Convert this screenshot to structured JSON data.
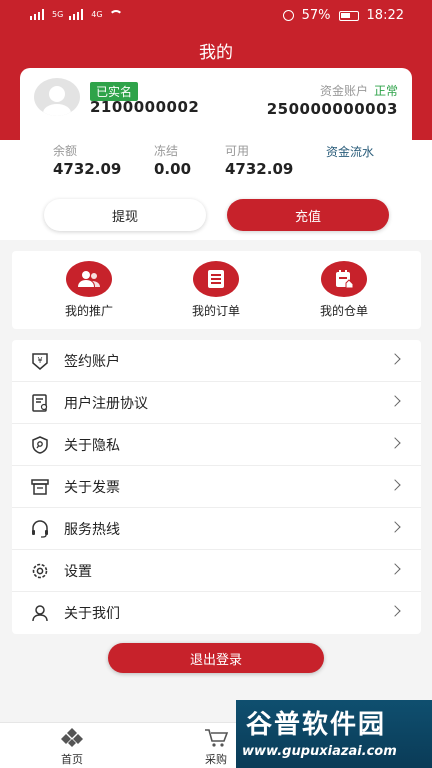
{
  "status_bar": {
    "left_indicators": [
      "5G",
      "4G"
    ],
    "battery": "57%",
    "time": "18:22"
  },
  "header": {
    "title": "我的"
  },
  "account": {
    "verified_badge": "已实名",
    "user_id": "2100000002",
    "fund_account_label": "资金账户",
    "fund_status": "正常",
    "fund_account_number": "250000000003",
    "stats": [
      {
        "label": "余额",
        "value": "4732.09"
      },
      {
        "label": "冻结",
        "value": "0.00"
      },
      {
        "label": "可用",
        "value": "4732.09"
      }
    ],
    "fund_flow_link": "资金流水",
    "withdraw_label": "提现",
    "recharge_label": "充值"
  },
  "shortcuts": [
    {
      "label": "我的推广",
      "icon": "users-icon"
    },
    {
      "label": "我的订单",
      "icon": "list-icon"
    },
    {
      "label": "我的仓单",
      "icon": "warehouse-receipt-icon"
    }
  ],
  "menu": [
    {
      "label": "签约账户",
      "icon": "yuan-shield-icon"
    },
    {
      "label": "用户注册协议",
      "icon": "document-user-icon"
    },
    {
      "label": "关于隐私",
      "icon": "privacy-shield-icon"
    },
    {
      "label": "关于发票",
      "icon": "invoice-icon"
    },
    {
      "label": "服务热线",
      "icon": "headset-icon"
    },
    {
      "label": "设置",
      "icon": "gear-icon"
    },
    {
      "label": "关于我们",
      "icon": "person-icon"
    }
  ],
  "logout_label": "退出登录",
  "bottom_nav": [
    {
      "label": "首页",
      "icon": "home-icon"
    },
    {
      "label": "采购",
      "icon": "cart-icon"
    }
  ],
  "watermark": {
    "title": "谷普软件园",
    "url": "www.gupuxiazai.com"
  },
  "colors": {
    "brand_red": "#c7222b",
    "success_green": "#2fa34a"
  }
}
